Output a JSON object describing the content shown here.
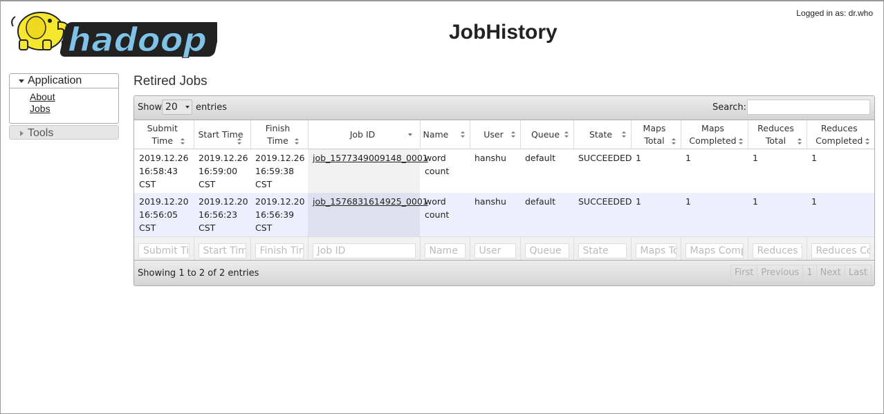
{
  "header": {
    "logo_text": "hadoop",
    "title": "JobHistory",
    "logged_in": "Logged in as: dr.who"
  },
  "sidebar": {
    "application": {
      "label": "Application",
      "links": [
        "About",
        "Jobs"
      ]
    },
    "tools": {
      "label": "Tools"
    }
  },
  "main": {
    "section_title": "Retired Jobs",
    "length_show": "Show",
    "length_value": "20",
    "length_entries": "entries",
    "search_label": "Search:",
    "search_value": ""
  },
  "table": {
    "columns": [
      {
        "line1": "Submit Time",
        "line2": ""
      },
      {
        "line1": "Start Time",
        "line2": ""
      },
      {
        "line1": "Finish Time",
        "line2": ""
      },
      {
        "line1": "Job ID",
        "line2": ""
      },
      {
        "line1": "Name",
        "line2": ""
      },
      {
        "line1": "User",
        "line2": ""
      },
      {
        "line1": "Queue",
        "line2": ""
      },
      {
        "line1": "State",
        "line2": ""
      },
      {
        "line1": "Maps",
        "line2": "Total"
      },
      {
        "line1": "Maps",
        "line2": "Completed"
      },
      {
        "line1": "Reduces",
        "line2": "Total"
      },
      {
        "line1": "Reduces",
        "line2": "Completed"
      }
    ],
    "rows": [
      {
        "submit_time": [
          "2019.12.26",
          "16:58:43",
          "CST"
        ],
        "start_time": [
          "2019.12.26",
          "16:59:00",
          "CST"
        ],
        "finish_time": [
          "2019.12.26",
          "16:59:38",
          "CST"
        ],
        "job_id": "job_1577349009148_0001",
        "name": [
          "word",
          "count"
        ],
        "user": "hanshu",
        "queue": "default",
        "state": "SUCCEEDED",
        "maps_total": "1",
        "maps_completed": "1",
        "reduces_total": "1",
        "reduces_completed": "1"
      },
      {
        "submit_time": [
          "2019.12.20",
          "16:56:05",
          "CST"
        ],
        "start_time": [
          "2019.12.20",
          "16:56:23",
          "CST"
        ],
        "finish_time": [
          "2019.12.20",
          "16:56:39",
          "CST"
        ],
        "job_id": "job_1576831614925_0001",
        "name": [
          "word",
          "count"
        ],
        "user": "hanshu",
        "queue": "default",
        "state": "SUCCEEDED",
        "maps_total": "1",
        "maps_completed": "1",
        "reduces_total": "1",
        "reduces_completed": "1"
      }
    ],
    "filter_placeholders": [
      "Submit Time",
      "Start Time",
      "Finish Time",
      "Job ID",
      "Name",
      "User",
      "Queue",
      "State",
      "Maps Total",
      "Maps Completed",
      "Reduces Total",
      "Reduces Completed"
    ],
    "info": "Showing 1 to 2 of 2 entries",
    "pager": [
      "First",
      "Previous",
      "1",
      "Next",
      "Last"
    ]
  },
  "colors": {
    "row_even": "#eeeffc",
    "sorted_col": "#e0e1ee",
    "logo_blue": "#7fc3e8",
    "logo_yellow": "#f5e62e"
  },
  "icons": {
    "elephant": "hadoop-elephant-icon",
    "expand": "triangle-down-icon",
    "collapsed": "triangle-right-icon",
    "sort": "sort-both-icon",
    "sort_desc": "sort-desc-icon"
  }
}
